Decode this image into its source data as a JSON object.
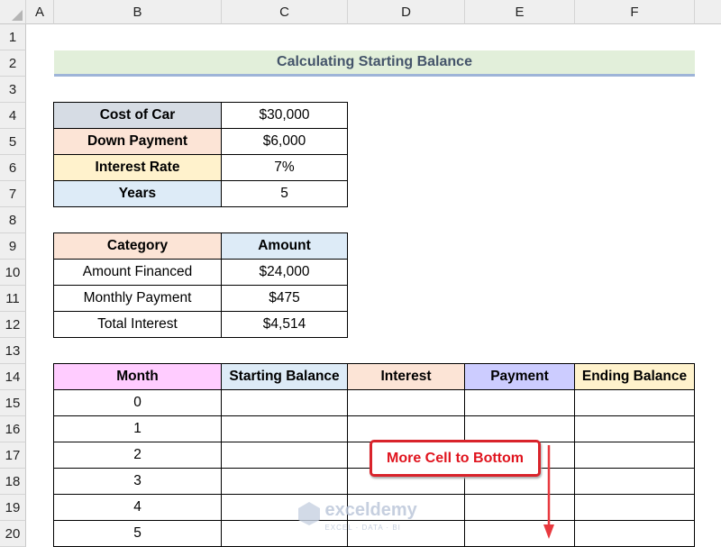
{
  "columns": [
    "A",
    "B",
    "C",
    "D",
    "E",
    "F"
  ],
  "rows": [
    "1",
    "2",
    "3",
    "4",
    "5",
    "6",
    "7",
    "8",
    "9",
    "10",
    "11",
    "12",
    "13",
    "14",
    "15",
    "16",
    "17",
    "18",
    "19",
    "20"
  ],
  "title": "Calculating Starting Balance",
  "inputs": [
    {
      "label": "Cost of Car",
      "value": "$30,000",
      "color": "#d6dce4"
    },
    {
      "label": "Down Payment",
      "value": "$6,000",
      "color": "#fce4d6"
    },
    {
      "label": "Interest Rate",
      "value": "7%",
      "color": "#fff2cc"
    },
    {
      "label": "Years",
      "value": "5",
      "color": "#ddebf7"
    }
  ],
  "summary": {
    "headers": [
      {
        "text": "Category",
        "color": "#fce4d6"
      },
      {
        "text": "Amount",
        "color": "#ddebf7"
      }
    ],
    "rows": [
      [
        "Amount Financed",
        "$24,000"
      ],
      [
        "Monthly Payment",
        "$475"
      ],
      [
        "Total Interest",
        "$4,514"
      ]
    ]
  },
  "schedule": {
    "headers": [
      {
        "text": "Month",
        "color": "#ffccff"
      },
      {
        "text": "Starting Balance",
        "color": "#ddebf7"
      },
      {
        "text": "Interest",
        "color": "#fce4d6"
      },
      {
        "text": "Payment",
        "color": "#ccccff"
      },
      {
        "text": "Ending Balance",
        "color": "#fff2cc"
      }
    ],
    "months": [
      "0",
      "1",
      "2",
      "3",
      "4",
      "5"
    ]
  },
  "callout": "More Cell to Bottom",
  "watermark": {
    "name": "exceldemy",
    "tagline": "EXCEL · DATA · BI"
  }
}
